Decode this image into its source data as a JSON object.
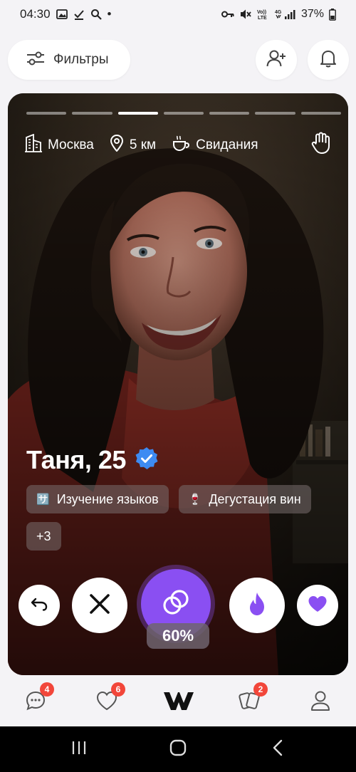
{
  "status_bar": {
    "time": "04:30",
    "dot": "•",
    "battery": "37%",
    "icons_left": [
      "gallery-icon",
      "download-done-icon",
      "search-icon"
    ],
    "icons_right": [
      "key-icon",
      "mute-icon",
      "volte-icon",
      "4g-signal-icon",
      "battery-icon"
    ]
  },
  "top_bar": {
    "filters_label": "Фильтры"
  },
  "card": {
    "story_count": 7,
    "story_active_index": 2,
    "city": "Москва",
    "distance": "5 км",
    "goal": "Свидания",
    "name_age": "Таня, 25",
    "tags": [
      {
        "emoji": "🈂️",
        "label": "Изучение языков"
      },
      {
        "emoji": "🍷",
        "label": "Дегустация вин"
      },
      {
        "emoji": "",
        "label": "+3"
      }
    ],
    "compatibility": "60%"
  },
  "tabbar": {
    "chats_badge": "4",
    "likes_badge": "6",
    "pairs_badge": "2"
  },
  "colors": {
    "accent": "#8a4ff2",
    "badge": "#f2463a",
    "verified": "#3d8bf2"
  }
}
